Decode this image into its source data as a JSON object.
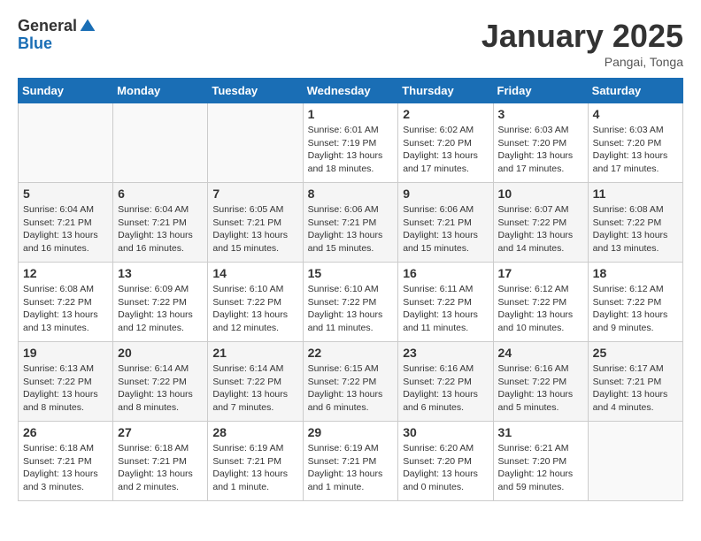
{
  "header": {
    "logo_general": "General",
    "logo_blue": "Blue",
    "month_title": "January 2025",
    "location": "Pangai, Tonga"
  },
  "days_of_week": [
    "Sunday",
    "Monday",
    "Tuesday",
    "Wednesday",
    "Thursday",
    "Friday",
    "Saturday"
  ],
  "weeks": [
    [
      {
        "day": "",
        "info": ""
      },
      {
        "day": "",
        "info": ""
      },
      {
        "day": "",
        "info": ""
      },
      {
        "day": "1",
        "info": "Sunrise: 6:01 AM\nSunset: 7:19 PM\nDaylight: 13 hours\nand 18 minutes."
      },
      {
        "day": "2",
        "info": "Sunrise: 6:02 AM\nSunset: 7:20 PM\nDaylight: 13 hours\nand 17 minutes."
      },
      {
        "day": "3",
        "info": "Sunrise: 6:03 AM\nSunset: 7:20 PM\nDaylight: 13 hours\nand 17 minutes."
      },
      {
        "day": "4",
        "info": "Sunrise: 6:03 AM\nSunset: 7:20 PM\nDaylight: 13 hours\nand 17 minutes."
      }
    ],
    [
      {
        "day": "5",
        "info": "Sunrise: 6:04 AM\nSunset: 7:21 PM\nDaylight: 13 hours\nand 16 minutes."
      },
      {
        "day": "6",
        "info": "Sunrise: 6:04 AM\nSunset: 7:21 PM\nDaylight: 13 hours\nand 16 minutes."
      },
      {
        "day": "7",
        "info": "Sunrise: 6:05 AM\nSunset: 7:21 PM\nDaylight: 13 hours\nand 15 minutes."
      },
      {
        "day": "8",
        "info": "Sunrise: 6:06 AM\nSunset: 7:21 PM\nDaylight: 13 hours\nand 15 minutes."
      },
      {
        "day": "9",
        "info": "Sunrise: 6:06 AM\nSunset: 7:21 PM\nDaylight: 13 hours\nand 15 minutes."
      },
      {
        "day": "10",
        "info": "Sunrise: 6:07 AM\nSunset: 7:22 PM\nDaylight: 13 hours\nand 14 minutes."
      },
      {
        "day": "11",
        "info": "Sunrise: 6:08 AM\nSunset: 7:22 PM\nDaylight: 13 hours\nand 13 minutes."
      }
    ],
    [
      {
        "day": "12",
        "info": "Sunrise: 6:08 AM\nSunset: 7:22 PM\nDaylight: 13 hours\nand 13 minutes."
      },
      {
        "day": "13",
        "info": "Sunrise: 6:09 AM\nSunset: 7:22 PM\nDaylight: 13 hours\nand 12 minutes."
      },
      {
        "day": "14",
        "info": "Sunrise: 6:10 AM\nSunset: 7:22 PM\nDaylight: 13 hours\nand 12 minutes."
      },
      {
        "day": "15",
        "info": "Sunrise: 6:10 AM\nSunset: 7:22 PM\nDaylight: 13 hours\nand 11 minutes."
      },
      {
        "day": "16",
        "info": "Sunrise: 6:11 AM\nSunset: 7:22 PM\nDaylight: 13 hours\nand 11 minutes."
      },
      {
        "day": "17",
        "info": "Sunrise: 6:12 AM\nSunset: 7:22 PM\nDaylight: 13 hours\nand 10 minutes."
      },
      {
        "day": "18",
        "info": "Sunrise: 6:12 AM\nSunset: 7:22 PM\nDaylight: 13 hours\nand 9 minutes."
      }
    ],
    [
      {
        "day": "19",
        "info": "Sunrise: 6:13 AM\nSunset: 7:22 PM\nDaylight: 13 hours\nand 8 minutes."
      },
      {
        "day": "20",
        "info": "Sunrise: 6:14 AM\nSunset: 7:22 PM\nDaylight: 13 hours\nand 8 minutes."
      },
      {
        "day": "21",
        "info": "Sunrise: 6:14 AM\nSunset: 7:22 PM\nDaylight: 13 hours\nand 7 minutes."
      },
      {
        "day": "22",
        "info": "Sunrise: 6:15 AM\nSunset: 7:22 PM\nDaylight: 13 hours\nand 6 minutes."
      },
      {
        "day": "23",
        "info": "Sunrise: 6:16 AM\nSunset: 7:22 PM\nDaylight: 13 hours\nand 6 minutes."
      },
      {
        "day": "24",
        "info": "Sunrise: 6:16 AM\nSunset: 7:22 PM\nDaylight: 13 hours\nand 5 minutes."
      },
      {
        "day": "25",
        "info": "Sunrise: 6:17 AM\nSunset: 7:21 PM\nDaylight: 13 hours\nand 4 minutes."
      }
    ],
    [
      {
        "day": "26",
        "info": "Sunrise: 6:18 AM\nSunset: 7:21 PM\nDaylight: 13 hours\nand 3 minutes."
      },
      {
        "day": "27",
        "info": "Sunrise: 6:18 AM\nSunset: 7:21 PM\nDaylight: 13 hours\nand 2 minutes."
      },
      {
        "day": "28",
        "info": "Sunrise: 6:19 AM\nSunset: 7:21 PM\nDaylight: 13 hours\nand 1 minute."
      },
      {
        "day": "29",
        "info": "Sunrise: 6:19 AM\nSunset: 7:21 PM\nDaylight: 13 hours\nand 1 minute."
      },
      {
        "day": "30",
        "info": "Sunrise: 6:20 AM\nSunset: 7:20 PM\nDaylight: 13 hours\nand 0 minutes."
      },
      {
        "day": "31",
        "info": "Sunrise: 6:21 AM\nSunset: 7:20 PM\nDaylight: 12 hours\nand 59 minutes."
      },
      {
        "day": "",
        "info": ""
      }
    ]
  ]
}
